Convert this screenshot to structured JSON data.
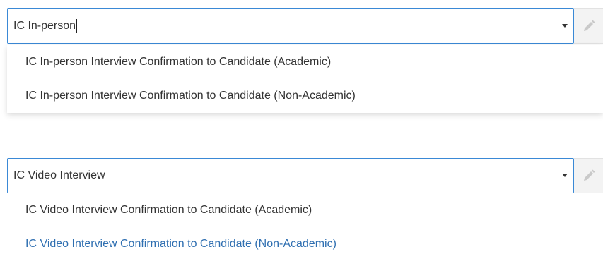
{
  "dropdown1": {
    "input_value": "IC In-person",
    "options": [
      "IC In-person Interview Confirmation to Candidate (Academic)",
      "IC In-person Interview Confirmation to Candidate (Non-Academic)"
    ]
  },
  "dropdown2": {
    "input_value": "IC Video Interview",
    "options": [
      "IC Video Interview Confirmation to Candidate (Academic)",
      "IC Video Interview Confirmation to Candidate (Non-Academic)"
    ],
    "highlighted_index": 1
  },
  "icons": {
    "arrow": "chevron-down-icon",
    "edit": "pencil-icon"
  },
  "colors": {
    "focus_border": "#3a89d6",
    "highlight_text": "#2f6fb1",
    "text": "#333333"
  }
}
